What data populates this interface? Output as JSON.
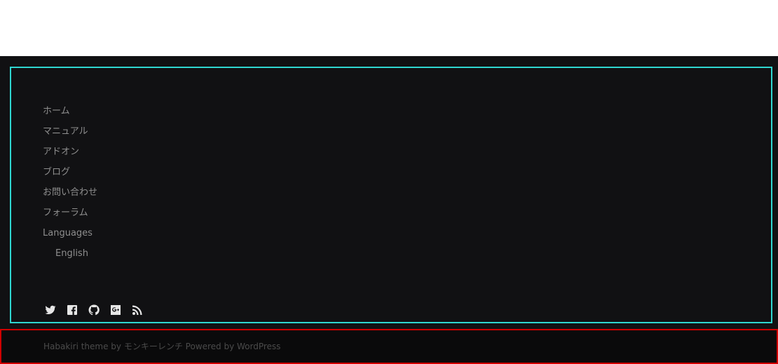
{
  "footer": {
    "menu": [
      {
        "label": "ホーム"
      },
      {
        "label": "マニュアル"
      },
      {
        "label": "アドオン"
      },
      {
        "label": "ブログ"
      },
      {
        "label": "お問い合わせ"
      },
      {
        "label": "フォーラム"
      },
      {
        "label": "Languages"
      },
      {
        "label": "English"
      }
    ],
    "social_icons": [
      "twitter-icon",
      "facebook-icon",
      "github-icon",
      "google-plus-icon",
      "rss-icon"
    ],
    "site_info": "Habakiri theme by モンキーレンチ Powered by WordPress"
  },
  "colors": {
    "background": "#111113",
    "widget_border": "#2fd6d0",
    "site_info_border": "#d00000",
    "menu_text": "#8e8e8e"
  }
}
